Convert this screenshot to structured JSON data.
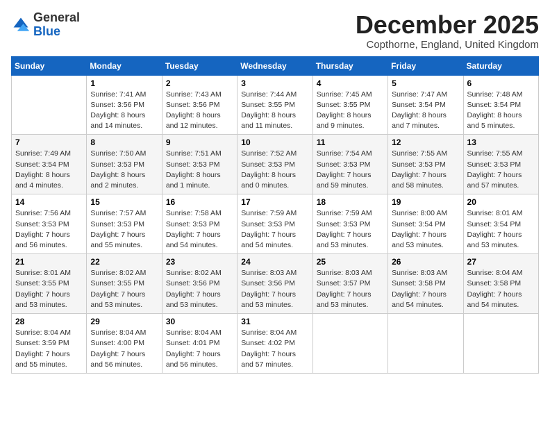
{
  "logo": {
    "general": "General",
    "blue": "Blue"
  },
  "header": {
    "month": "December 2025",
    "location": "Copthorne, England, United Kingdom"
  },
  "weekdays": [
    "Sunday",
    "Monday",
    "Tuesday",
    "Wednesday",
    "Thursday",
    "Friday",
    "Saturday"
  ],
  "weeks": [
    [
      {
        "day": "",
        "sunrise": "",
        "sunset": "",
        "daylight": ""
      },
      {
        "day": "1",
        "sunrise": "Sunrise: 7:41 AM",
        "sunset": "Sunset: 3:56 PM",
        "daylight": "Daylight: 8 hours and 14 minutes."
      },
      {
        "day": "2",
        "sunrise": "Sunrise: 7:43 AM",
        "sunset": "Sunset: 3:56 PM",
        "daylight": "Daylight: 8 hours and 12 minutes."
      },
      {
        "day": "3",
        "sunrise": "Sunrise: 7:44 AM",
        "sunset": "Sunset: 3:55 PM",
        "daylight": "Daylight: 8 hours and 11 minutes."
      },
      {
        "day": "4",
        "sunrise": "Sunrise: 7:45 AM",
        "sunset": "Sunset: 3:55 PM",
        "daylight": "Daylight: 8 hours and 9 minutes."
      },
      {
        "day": "5",
        "sunrise": "Sunrise: 7:47 AM",
        "sunset": "Sunset: 3:54 PM",
        "daylight": "Daylight: 8 hours and 7 minutes."
      },
      {
        "day": "6",
        "sunrise": "Sunrise: 7:48 AM",
        "sunset": "Sunset: 3:54 PM",
        "daylight": "Daylight: 8 hours and 5 minutes."
      }
    ],
    [
      {
        "day": "7",
        "sunrise": "Sunrise: 7:49 AM",
        "sunset": "Sunset: 3:54 PM",
        "daylight": "Daylight: 8 hours and 4 minutes."
      },
      {
        "day": "8",
        "sunrise": "Sunrise: 7:50 AM",
        "sunset": "Sunset: 3:53 PM",
        "daylight": "Daylight: 8 hours and 2 minutes."
      },
      {
        "day": "9",
        "sunrise": "Sunrise: 7:51 AM",
        "sunset": "Sunset: 3:53 PM",
        "daylight": "Daylight: 8 hours and 1 minute."
      },
      {
        "day": "10",
        "sunrise": "Sunrise: 7:52 AM",
        "sunset": "Sunset: 3:53 PM",
        "daylight": "Daylight: 8 hours and 0 minutes."
      },
      {
        "day": "11",
        "sunrise": "Sunrise: 7:54 AM",
        "sunset": "Sunset: 3:53 PM",
        "daylight": "Daylight: 7 hours and 59 minutes."
      },
      {
        "day": "12",
        "sunrise": "Sunrise: 7:55 AM",
        "sunset": "Sunset: 3:53 PM",
        "daylight": "Daylight: 7 hours and 58 minutes."
      },
      {
        "day": "13",
        "sunrise": "Sunrise: 7:55 AM",
        "sunset": "Sunset: 3:53 PM",
        "daylight": "Daylight: 7 hours and 57 minutes."
      }
    ],
    [
      {
        "day": "14",
        "sunrise": "Sunrise: 7:56 AM",
        "sunset": "Sunset: 3:53 PM",
        "daylight": "Daylight: 7 hours and 56 minutes."
      },
      {
        "day": "15",
        "sunrise": "Sunrise: 7:57 AM",
        "sunset": "Sunset: 3:53 PM",
        "daylight": "Daylight: 7 hours and 55 minutes."
      },
      {
        "day": "16",
        "sunrise": "Sunrise: 7:58 AM",
        "sunset": "Sunset: 3:53 PM",
        "daylight": "Daylight: 7 hours and 54 minutes."
      },
      {
        "day": "17",
        "sunrise": "Sunrise: 7:59 AM",
        "sunset": "Sunset: 3:53 PM",
        "daylight": "Daylight: 7 hours and 54 minutes."
      },
      {
        "day": "18",
        "sunrise": "Sunrise: 7:59 AM",
        "sunset": "Sunset: 3:53 PM",
        "daylight": "Daylight: 7 hours and 53 minutes."
      },
      {
        "day": "19",
        "sunrise": "Sunrise: 8:00 AM",
        "sunset": "Sunset: 3:54 PM",
        "daylight": "Daylight: 7 hours and 53 minutes."
      },
      {
        "day": "20",
        "sunrise": "Sunrise: 8:01 AM",
        "sunset": "Sunset: 3:54 PM",
        "daylight": "Daylight: 7 hours and 53 minutes."
      }
    ],
    [
      {
        "day": "21",
        "sunrise": "Sunrise: 8:01 AM",
        "sunset": "Sunset: 3:55 PM",
        "daylight": "Daylight: 7 hours and 53 minutes."
      },
      {
        "day": "22",
        "sunrise": "Sunrise: 8:02 AM",
        "sunset": "Sunset: 3:55 PM",
        "daylight": "Daylight: 7 hours and 53 minutes."
      },
      {
        "day": "23",
        "sunrise": "Sunrise: 8:02 AM",
        "sunset": "Sunset: 3:56 PM",
        "daylight": "Daylight: 7 hours and 53 minutes."
      },
      {
        "day": "24",
        "sunrise": "Sunrise: 8:03 AM",
        "sunset": "Sunset: 3:56 PM",
        "daylight": "Daylight: 7 hours and 53 minutes."
      },
      {
        "day": "25",
        "sunrise": "Sunrise: 8:03 AM",
        "sunset": "Sunset: 3:57 PM",
        "daylight": "Daylight: 7 hours and 53 minutes."
      },
      {
        "day": "26",
        "sunrise": "Sunrise: 8:03 AM",
        "sunset": "Sunset: 3:58 PM",
        "daylight": "Daylight: 7 hours and 54 minutes."
      },
      {
        "day": "27",
        "sunrise": "Sunrise: 8:04 AM",
        "sunset": "Sunset: 3:58 PM",
        "daylight": "Daylight: 7 hours and 54 minutes."
      }
    ],
    [
      {
        "day": "28",
        "sunrise": "Sunrise: 8:04 AM",
        "sunset": "Sunset: 3:59 PM",
        "daylight": "Daylight: 7 hours and 55 minutes."
      },
      {
        "day": "29",
        "sunrise": "Sunrise: 8:04 AM",
        "sunset": "Sunset: 4:00 PM",
        "daylight": "Daylight: 7 hours and 56 minutes."
      },
      {
        "day": "30",
        "sunrise": "Sunrise: 8:04 AM",
        "sunset": "Sunset: 4:01 PM",
        "daylight": "Daylight: 7 hours and 56 minutes."
      },
      {
        "day": "31",
        "sunrise": "Sunrise: 8:04 AM",
        "sunset": "Sunset: 4:02 PM",
        "daylight": "Daylight: 7 hours and 57 minutes."
      },
      {
        "day": "",
        "sunrise": "",
        "sunset": "",
        "daylight": ""
      },
      {
        "day": "",
        "sunrise": "",
        "sunset": "",
        "daylight": ""
      },
      {
        "day": "",
        "sunrise": "",
        "sunset": "",
        "daylight": ""
      }
    ]
  ]
}
